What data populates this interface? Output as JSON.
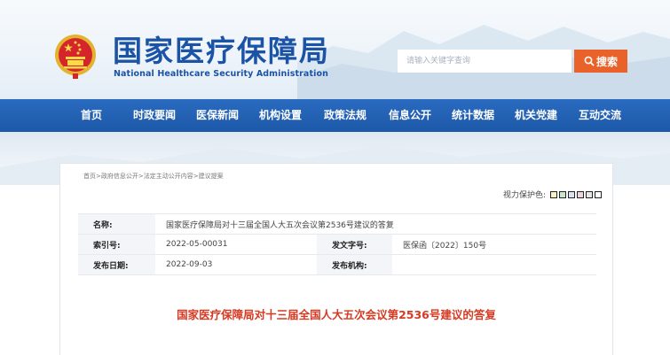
{
  "header": {
    "title_cn": "国家医疗保障局",
    "title_en": "National Healthcare Security Administration"
  },
  "search": {
    "placeholder": "请输入关键字查询",
    "button_label": "搜索"
  },
  "nav": {
    "items": [
      "首页",
      "时政要闻",
      "医保新闻",
      "机构设置",
      "政策法规",
      "信息公开",
      "统计数据",
      "机关党建",
      "互动交流"
    ]
  },
  "breadcrumb": {
    "items": [
      "首页",
      "政府信息公开",
      "法定主动公开内容",
      "建议提案"
    ],
    "separator": ">"
  },
  "eye_protect": {
    "label": "视力保护色:",
    "colors": [
      "#f8f3c4",
      "#c9e6cf",
      "#dce1f6",
      "#f0d5e1",
      "#e8e8e8",
      "#ffffff"
    ]
  },
  "meta": {
    "name_label": "名称:",
    "name_value": "国家医疗保障局对十三届全国人大五次会议第2536号建议的答复",
    "index_label": "索引号:",
    "index_value": "2022-05-00031",
    "docno_label": "发文字号:",
    "docno_value": "医保函〔2022〕150号",
    "date_label": "发布日期:",
    "date_value": "2022-09-03",
    "org_label": "发布机构:",
    "org_value": ""
  },
  "document": {
    "title": "国家医疗保障局对十三届全国人大五次会议第2536号建议的答复"
  },
  "colors": {
    "brand_blue": "#1b53a6",
    "nav_blue": "#2360b4",
    "search_orange": "#e8622a",
    "title_red": "#d63a22"
  }
}
